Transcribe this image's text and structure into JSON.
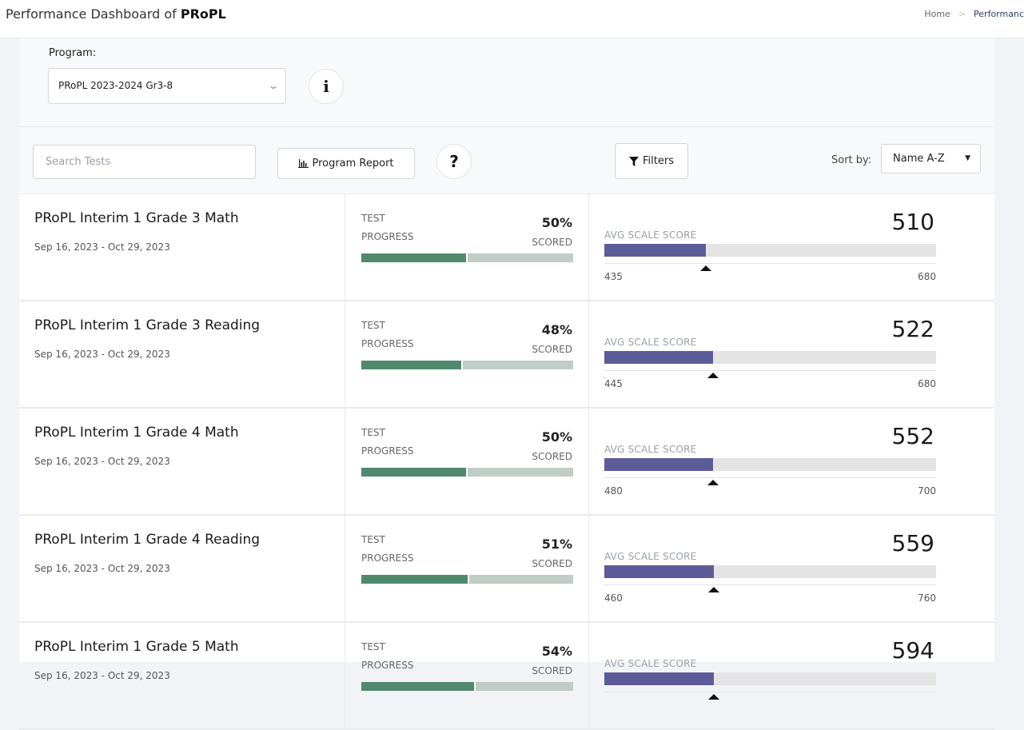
{
  "header": {
    "title_prefix": "Performance Dashboard of ",
    "title_bold": "PRoPL",
    "breadcrumb": [
      {
        "label": "Home"
      },
      {
        "label": "Performanc"
      }
    ],
    "breadcrumb_separator": ">"
  },
  "program": {
    "label": "Program:",
    "selected": "PRoPL 2023-2024 Gr3-8",
    "info_icon": "info-icon",
    "info_glyph": "i"
  },
  "toolbar": {
    "search_placeholder": "Search Tests",
    "report_label": "Program Report",
    "report_icon": "bar-chart-icon",
    "help_glyph": "?",
    "filters_label": "Filters",
    "filters_icon": "filter-icon",
    "sort_label": "Sort by:",
    "sort_value": "Name A-Z"
  },
  "rows_labels": {
    "progress_label": "TEST PROGRESS",
    "scored_label": "SCORED",
    "avg_label": "AVG SCALE SCORE"
  },
  "tests": [
    {
      "name": "PRoPL Interim 1 Grade 3 Math",
      "dates": "Sep 16, 2023 - Oct 29, 2023",
      "progress": "50%",
      "progress_value": 0.5,
      "avg_score": "510",
      "score_min": "435",
      "score_max": "680",
      "score_fill": 0.306,
      "marker": 0.306
    },
    {
      "name": "PRoPL Interim 1 Grade 3 Reading",
      "dates": "Sep 16, 2023 - Oct 29, 2023",
      "progress": "48%",
      "progress_value": 0.48,
      "avg_score": "522",
      "score_min": "445",
      "score_max": "680",
      "score_fill": 0.328,
      "marker": 0.328
    },
    {
      "name": "PRoPL Interim 1 Grade 4 Math",
      "dates": "Sep 16, 2023 - Oct 29, 2023",
      "progress": "50%",
      "progress_value": 0.5,
      "avg_score": "552",
      "score_min": "480",
      "score_max": "700",
      "score_fill": 0.327,
      "marker": 0.327
    },
    {
      "name": "PRoPL Interim 1 Grade 4 Reading",
      "dates": "Sep 16, 2023 - Oct 29, 2023",
      "progress": "51%",
      "progress_value": 0.51,
      "avg_score": "559",
      "score_min": "460",
      "score_max": "760",
      "score_fill": 0.33,
      "marker": 0.33
    },
    {
      "name": "PRoPL Interim 1 Grade 5 Math",
      "dates": "Sep 16, 2023 - Oct 29, 2023",
      "progress": "54%",
      "progress_value": 0.54,
      "avg_score": "594",
      "score_min": "",
      "score_max": "",
      "score_fill": 0.33,
      "marker": 0.33
    }
  ],
  "colors": {
    "progress_fill": "#51896f",
    "progress_track": "#bfcdc6",
    "score_fill": "#5c5c99",
    "score_track": "#e4e4e4"
  }
}
